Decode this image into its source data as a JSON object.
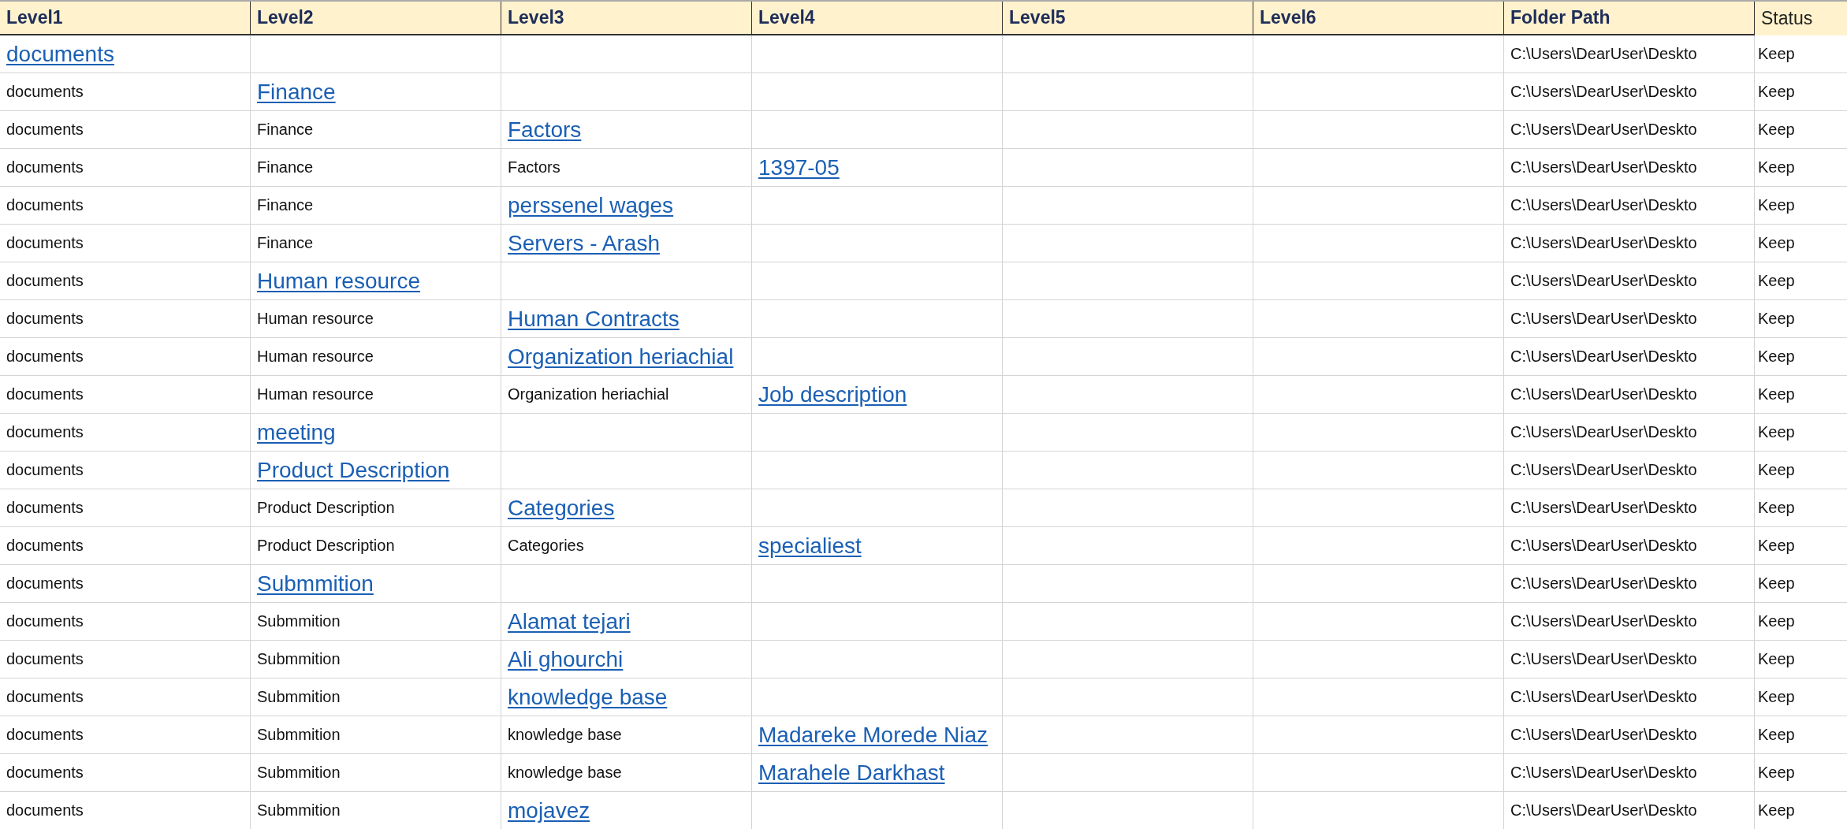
{
  "columns": [
    {
      "label": "Level1",
      "bold": true
    },
    {
      "label": "Level2",
      "bold": true
    },
    {
      "label": "Level3",
      "bold": true
    },
    {
      "label": "Level4",
      "bold": true
    },
    {
      "label": "Level5",
      "bold": true
    },
    {
      "label": "Level6",
      "bold": true
    },
    {
      "label": "Folder Path",
      "bold": true
    },
    {
      "label": "Status",
      "bold": false
    }
  ],
  "rows": [
    {
      "path": [
        "documents"
      ],
      "folder_path": "C:\\Users\\DearUser\\Deskto",
      "status": "Keep"
    },
    {
      "path": [
        "documents",
        "Finance"
      ],
      "folder_path": "C:\\Users\\DearUser\\Deskto",
      "status": "Keep"
    },
    {
      "path": [
        "documents",
        "Finance",
        "Factors"
      ],
      "folder_path": "C:\\Users\\DearUser\\Deskto",
      "status": "Keep"
    },
    {
      "path": [
        "documents",
        "Finance",
        "Factors",
        "1397-05"
      ],
      "folder_path": "C:\\Users\\DearUser\\Deskto",
      "status": "Keep"
    },
    {
      "path": [
        "documents",
        "Finance",
        "perssenel wages"
      ],
      "folder_path": "C:\\Users\\DearUser\\Deskto",
      "status": "Keep"
    },
    {
      "path": [
        "documents",
        "Finance",
        "Servers - Arash"
      ],
      "folder_path": "C:\\Users\\DearUser\\Deskto",
      "status": "Keep"
    },
    {
      "path": [
        "documents",
        "Human resource"
      ],
      "folder_path": "C:\\Users\\DearUser\\Deskto",
      "status": "Keep"
    },
    {
      "path": [
        "documents",
        "Human resource",
        "Human Contracts"
      ],
      "folder_path": "C:\\Users\\DearUser\\Deskto",
      "status": "Keep"
    },
    {
      "path": [
        "documents",
        "Human resource",
        "Organization heriachial"
      ],
      "folder_path": "C:\\Users\\DearUser\\Deskto",
      "status": "Keep"
    },
    {
      "path": [
        "documents",
        "Human resource",
        "Organization heriachial",
        "Job description"
      ],
      "folder_path": "C:\\Users\\DearUser\\Deskto",
      "status": "Keep"
    },
    {
      "path": [
        "documents",
        "meeting"
      ],
      "folder_path": "C:\\Users\\DearUser\\Deskto",
      "status": "Keep"
    },
    {
      "path": [
        "documents",
        "Product Description"
      ],
      "folder_path": "C:\\Users\\DearUser\\Deskto",
      "status": "Keep"
    },
    {
      "path": [
        "documents",
        "Product Description",
        "Categories"
      ],
      "folder_path": "C:\\Users\\DearUser\\Deskto",
      "status": "Keep"
    },
    {
      "path": [
        "documents",
        "Product Description",
        "Categories",
        "specialiest"
      ],
      "folder_path": "C:\\Users\\DearUser\\Deskto",
      "status": "Keep"
    },
    {
      "path": [
        "documents",
        "Submmition"
      ],
      "folder_path": "C:\\Users\\DearUser\\Deskto",
      "status": "Keep"
    },
    {
      "path": [
        "documents",
        "Submmition",
        "Alamat tejari"
      ],
      "folder_path": "C:\\Users\\DearUser\\Deskto",
      "status": "Keep"
    },
    {
      "path": [
        "documents",
        "Submmition",
        "Ali ghourchi"
      ],
      "folder_path": "C:\\Users\\DearUser\\Deskto",
      "status": "Keep"
    },
    {
      "path": [
        "documents",
        "Submmition",
        "knowledge base"
      ],
      "folder_path": "C:\\Users\\DearUser\\Deskto",
      "status": "Keep"
    },
    {
      "path": [
        "documents",
        "Submmition",
        "knowledge base",
        "Madareke Morede Niaz"
      ],
      "folder_path": "C:\\Users\\DearUser\\Deskto",
      "status": "Keep"
    },
    {
      "path": [
        "documents",
        "Submmition",
        "knowledge base",
        "Marahele Darkhast"
      ],
      "folder_path": "C:\\Users\\DearUser\\Deskto",
      "status": "Keep"
    },
    {
      "path": [
        "documents",
        "Submmition",
        "mojavez"
      ],
      "folder_path": "C:\\Users\\DearUser\\Deskto",
      "status": "Keep"
    }
  ]
}
